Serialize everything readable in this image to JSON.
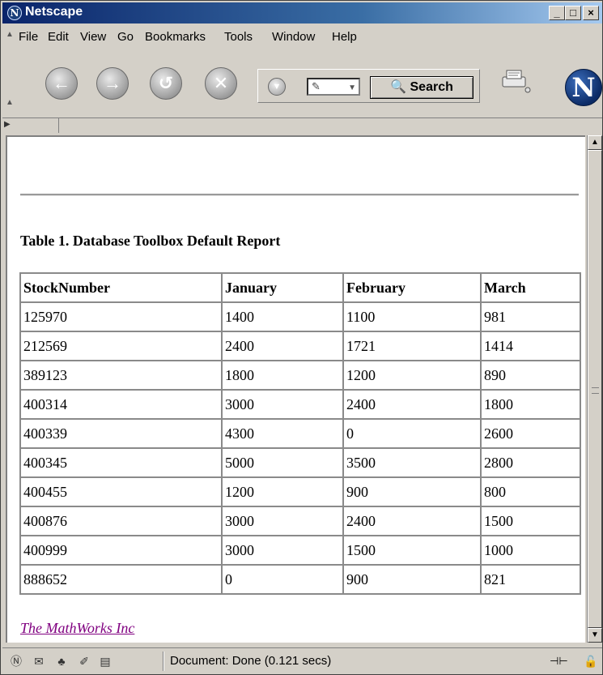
{
  "window": {
    "title": "Netscape"
  },
  "menu": {
    "items": [
      "File",
      "Edit",
      "View",
      "Go",
      "Bookmarks",
      "Tools",
      "Window",
      "Help"
    ]
  },
  "toolbar": {
    "search_label": "Search"
  },
  "page": {
    "caption": "Table 1. Database Toolbox Default Report",
    "table": {
      "headers": [
        "StockNumber",
        "January",
        "February",
        "March"
      ],
      "rows": [
        [
          "125970",
          "1400",
          "1100",
          "981"
        ],
        [
          "212569",
          "2400",
          "1721",
          "1414"
        ],
        [
          "389123",
          "1800",
          "1200",
          "890"
        ],
        [
          "400314",
          "3000",
          "2400",
          "1800"
        ],
        [
          "400339",
          "4300",
          "0",
          "2600"
        ],
        [
          "400345",
          "5000",
          "3500",
          "2800"
        ],
        [
          "400455",
          "1200",
          "900",
          "800"
        ],
        [
          "400876",
          "3000",
          "2400",
          "1500"
        ],
        [
          "400999",
          "3000",
          "1500",
          "1000"
        ],
        [
          "888652",
          "0",
          "900",
          "821"
        ]
      ]
    },
    "footer_link": "The MathWorks Inc"
  },
  "status": {
    "text": "Document: Done (0.121 secs)"
  }
}
